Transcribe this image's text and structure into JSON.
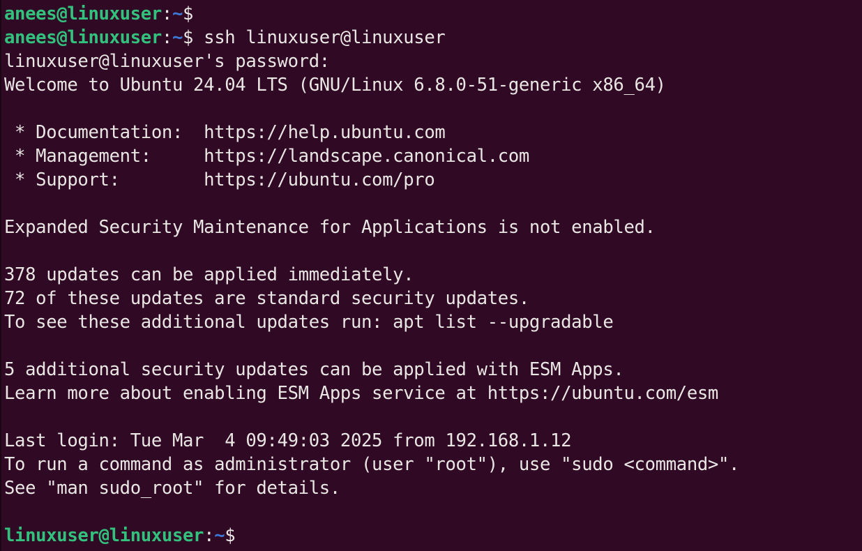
{
  "terminal": {
    "lines": [
      {
        "user": "anees@linuxuser",
        "sep": ":",
        "path": "~",
        "prompt": "$",
        "cmd": ""
      },
      {
        "user": "anees@linuxuser",
        "sep": ":",
        "path": "~",
        "prompt": "$",
        "cmd": " ssh linuxuser@linuxuser"
      },
      {
        "text": "linuxuser@linuxuser's password:"
      },
      {
        "text": "Welcome to Ubuntu 24.04 LTS (GNU/Linux 6.8.0-51-generic x86_64)"
      },
      {
        "text": ""
      },
      {
        "text": " * Documentation:  https://help.ubuntu.com"
      },
      {
        "text": " * Management:     https://landscape.canonical.com"
      },
      {
        "text": " * Support:        https://ubuntu.com/pro"
      },
      {
        "text": ""
      },
      {
        "text": "Expanded Security Maintenance for Applications is not enabled."
      },
      {
        "text": ""
      },
      {
        "text": "378 updates can be applied immediately."
      },
      {
        "text": "72 of these updates are standard security updates."
      },
      {
        "text": "To see these additional updates run: apt list --upgradable"
      },
      {
        "text": ""
      },
      {
        "text": "5 additional security updates can be applied with ESM Apps."
      },
      {
        "text": "Learn more about enabling ESM Apps service at https://ubuntu.com/esm"
      },
      {
        "text": ""
      },
      {
        "text": "Last login: Tue Mar  4 09:49:03 2025 from 192.168.1.12"
      },
      {
        "text": "To run a command as administrator (user \"root\"), use \"sudo <command>\"."
      },
      {
        "text": "See \"man sudo_root\" for details."
      },
      {
        "text": ""
      },
      {
        "user": "linuxuser@linuxuser",
        "sep": ":",
        "path": "~",
        "prompt": "$",
        "cmd": ""
      }
    ]
  },
  "colors": {
    "background": "#300a24",
    "prompt_user": "#33c27e",
    "prompt_path": "#3d79d6",
    "text": "#e9e6e4"
  }
}
